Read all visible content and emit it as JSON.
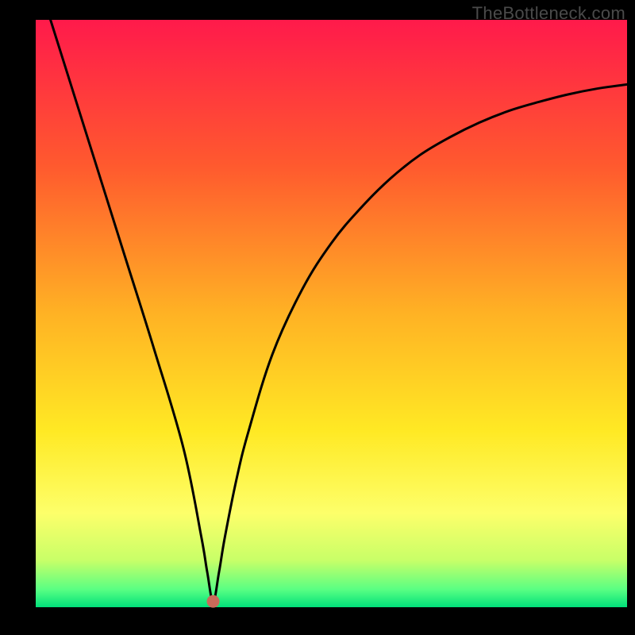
{
  "watermark": "TheBottleneck.com",
  "chart_data": {
    "type": "line",
    "title": "",
    "xlabel": "",
    "ylabel": "",
    "xlim": [
      0,
      100
    ],
    "ylim": [
      0,
      100
    ],
    "grid": false,
    "legend": false,
    "annotations": [
      {
        "type": "dot",
        "x": 30,
        "y": 1,
        "color": "#c96a5a",
        "radius": 8
      }
    ],
    "series": [
      {
        "name": "curve",
        "type": "line",
        "x": [
          2.5,
          5,
          10,
          15,
          20,
          25,
          28,
          29,
          30,
          31,
          32,
          34,
          36,
          40,
          45,
          50,
          55,
          60,
          65,
          70,
          75,
          80,
          85,
          90,
          95,
          100
        ],
        "values": [
          100,
          92,
          76,
          60,
          44,
          27,
          12,
          6,
          1,
          6,
          12,
          22,
          30,
          43,
          54,
          62,
          68,
          73,
          77,
          80,
          82.5,
          84.5,
          86,
          87.3,
          88.3,
          89
        ]
      }
    ],
    "background_gradient": {
      "stops": [
        {
          "offset": 0.0,
          "color": "#ff1a4b"
        },
        {
          "offset": 0.25,
          "color": "#ff5a2e"
        },
        {
          "offset": 0.5,
          "color": "#ffb224"
        },
        {
          "offset": 0.7,
          "color": "#ffe924"
        },
        {
          "offset": 0.84,
          "color": "#fdff6a"
        },
        {
          "offset": 0.92,
          "color": "#c8ff68"
        },
        {
          "offset": 0.97,
          "color": "#59ff83"
        },
        {
          "offset": 1.0,
          "color": "#00e07a"
        }
      ]
    },
    "plot_frame": {
      "outer_background": "#000000",
      "margin_left": 45,
      "margin_right": 10,
      "margin_top": 25,
      "margin_bottom": 35
    }
  }
}
